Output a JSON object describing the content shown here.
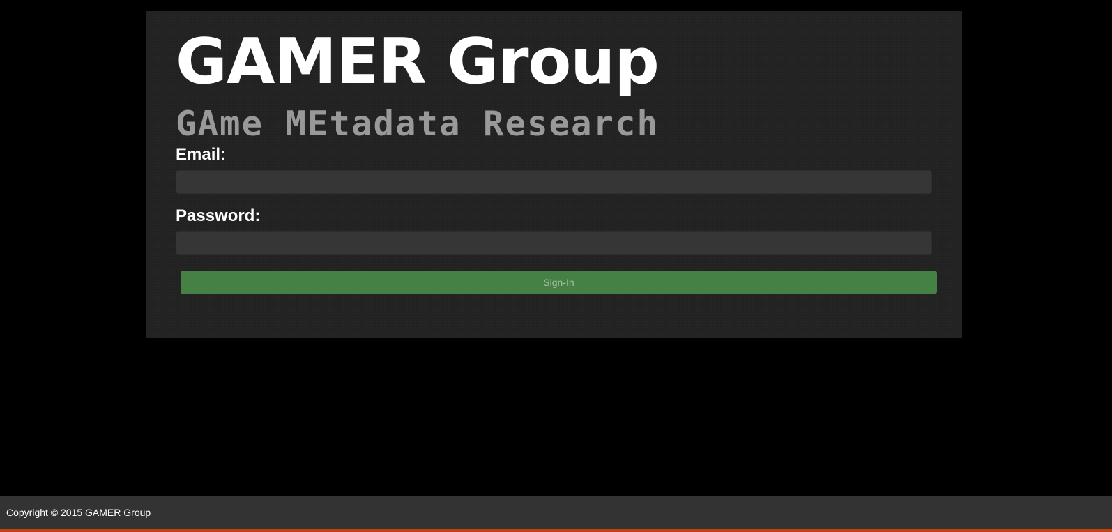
{
  "header": {
    "title": "GAMER Group",
    "subtitle": "GAme MEtadata Research"
  },
  "login_form": {
    "email_label": "Email:",
    "email_value": "",
    "password_label": "Password:",
    "password_value": "",
    "submit_label": "Sign-In"
  },
  "footer": {
    "copyright": "Copyright © 2015 GAMER Group"
  },
  "colors": {
    "background": "#000000",
    "panel": "#222222",
    "input": "#363636",
    "button": "#458145",
    "footer": "#333333",
    "accent": "#c4420f"
  }
}
